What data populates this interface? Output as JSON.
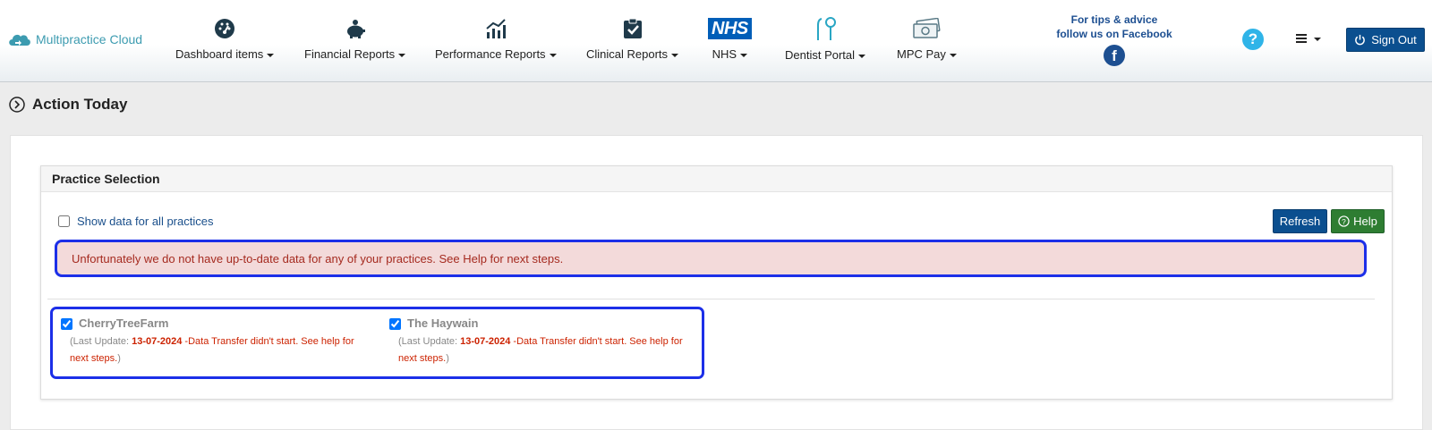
{
  "brand": {
    "name": "Multipractice Cloud",
    "color": "#3c9bb0"
  },
  "nav": [
    {
      "label": "Dashboard items",
      "icon": "dashboard-gauge-icon"
    },
    {
      "label": "Financial Reports",
      "icon": "piggy-bank-icon"
    },
    {
      "label": "Performance Reports",
      "icon": "bar-chart-trend-icon"
    },
    {
      "label": "Clinical Reports",
      "icon": "clipboard-check-icon"
    },
    {
      "label": "NHS",
      "icon": "nhs-logo-icon",
      "logo_text": "NHS"
    },
    {
      "label": "Dentist Portal",
      "icon": "dental-tools-icon"
    },
    {
      "label": "MPC Pay",
      "icon": "cash-icon"
    }
  ],
  "facebook": {
    "line1": "For tips & advice",
    "line2": "follow us on Facebook",
    "icon_text": "f"
  },
  "header_actions": {
    "help_icon_text": "?",
    "signout_label": "Sign Out"
  },
  "page": {
    "title": "Action Today"
  },
  "practice_selection": {
    "heading": "Practice Selection",
    "show_all_label": "Show data for all practices",
    "show_all_checked": false,
    "refresh_label": "Refresh",
    "help_label": "Help",
    "alert": "Unfortunately we do not have up-to-date data for any of your practices. See Help for next steps.",
    "practices": [
      {
        "name": "CherryTreeFarm",
        "checked": true,
        "prefix": "(Last Update: ",
        "date": "13-07-2024",
        "message": " -Data Transfer didn't start. See help for next steps.",
        "suffix": ")"
      },
      {
        "name": "The Haywain",
        "checked": true,
        "prefix": "(Last Update: ",
        "date": "13-07-2024",
        "message": " -Data Transfer didn't start. See help for next steps.",
        "suffix": ")"
      }
    ]
  },
  "colors": {
    "primary_button": "#0b4f8f",
    "help_button": "#2e7d32",
    "alert_bg": "#f3dada",
    "alert_text": "#a52a1f",
    "highlight_border": "#1c2fe8",
    "error_text": "#cc2200",
    "facebook_blue": "#1d4f91"
  }
}
